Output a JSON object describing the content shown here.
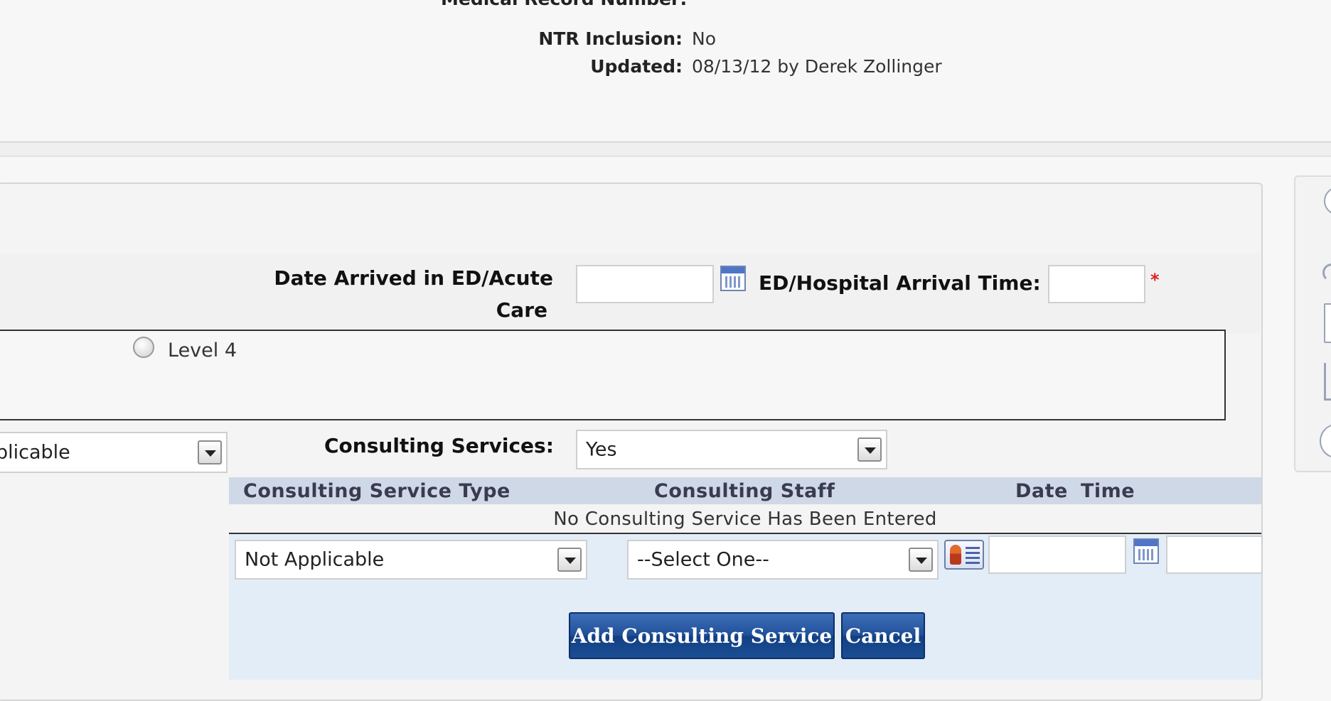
{
  "header": {
    "mrn_label": "Medical Record Number:",
    "ntr_label": "NTR Inclusion:",
    "ntr_value": "No",
    "updated_label": "Updated:",
    "updated_value": "08/13/12 by Derek Zollinger"
  },
  "form": {
    "date_arrived_label_line1": "Date Arrived in ED/Acute",
    "date_arrived_label_line2": "Care",
    "date_arrived_value": "",
    "arrival_time_label": "ED/Hospital Arrival Time:",
    "arrival_time_value": "",
    "required_marker": "*",
    "level_option": "Level 4",
    "left_select_value": "plicable",
    "consulting_services_label": "Consulting Services:",
    "consulting_services_value": "Yes"
  },
  "consulting_grid": {
    "columns": [
      "Consulting Service Type",
      "Consulting Staff",
      "Date",
      "Time"
    ],
    "empty_message": "No Consulting Service Has Been Entered",
    "service_type_value": "Not Applicable",
    "staff_value": "--Select One--",
    "date_value": "",
    "time_value": ""
  },
  "buttons": {
    "add_label": "Add Consulting Service",
    "cancel_label": "Cancel"
  },
  "icons": {
    "calendar": "calendar-icon",
    "staff_lookup": "staff-lookup-icon",
    "dropdown": "chevron-down-icon"
  },
  "colors": {
    "button_blue": "#1f4f98",
    "grid_header": "#cfd8e6",
    "entry_area": "#e3edf7",
    "required": "#e02020"
  }
}
